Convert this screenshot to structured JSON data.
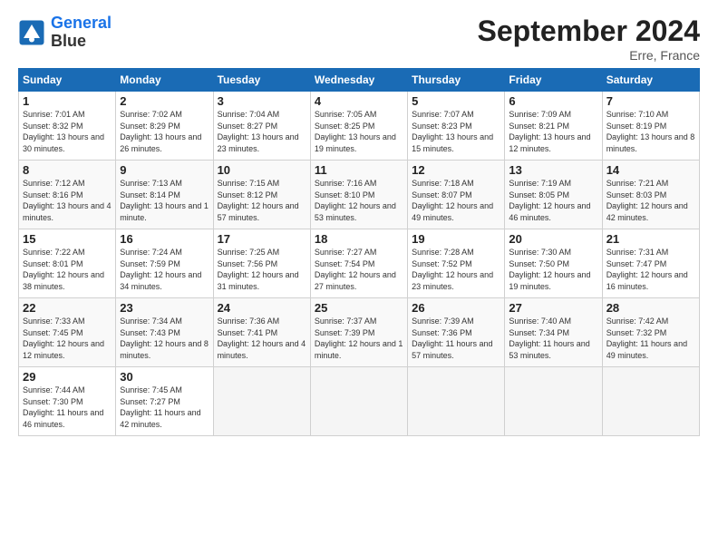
{
  "header": {
    "logo_line1": "General",
    "logo_line2": "Blue",
    "title": "September 2024",
    "location": "Erre, France"
  },
  "days_of_week": [
    "Sunday",
    "Monday",
    "Tuesday",
    "Wednesday",
    "Thursday",
    "Friday",
    "Saturday"
  ],
  "weeks": [
    [
      {
        "num": "1",
        "sunrise": "Sunrise: 7:01 AM",
        "sunset": "Sunset: 8:32 PM",
        "daylight": "Daylight: 13 hours and 30 minutes."
      },
      {
        "num": "2",
        "sunrise": "Sunrise: 7:02 AM",
        "sunset": "Sunset: 8:29 PM",
        "daylight": "Daylight: 13 hours and 26 minutes."
      },
      {
        "num": "3",
        "sunrise": "Sunrise: 7:04 AM",
        "sunset": "Sunset: 8:27 PM",
        "daylight": "Daylight: 13 hours and 23 minutes."
      },
      {
        "num": "4",
        "sunrise": "Sunrise: 7:05 AM",
        "sunset": "Sunset: 8:25 PM",
        "daylight": "Daylight: 13 hours and 19 minutes."
      },
      {
        "num": "5",
        "sunrise": "Sunrise: 7:07 AM",
        "sunset": "Sunset: 8:23 PM",
        "daylight": "Daylight: 13 hours and 15 minutes."
      },
      {
        "num": "6",
        "sunrise": "Sunrise: 7:09 AM",
        "sunset": "Sunset: 8:21 PM",
        "daylight": "Daylight: 13 hours and 12 minutes."
      },
      {
        "num": "7",
        "sunrise": "Sunrise: 7:10 AM",
        "sunset": "Sunset: 8:19 PM",
        "daylight": "Daylight: 13 hours and 8 minutes."
      }
    ],
    [
      {
        "num": "8",
        "sunrise": "Sunrise: 7:12 AM",
        "sunset": "Sunset: 8:16 PM",
        "daylight": "Daylight: 13 hours and 4 minutes."
      },
      {
        "num": "9",
        "sunrise": "Sunrise: 7:13 AM",
        "sunset": "Sunset: 8:14 PM",
        "daylight": "Daylight: 13 hours and 1 minute."
      },
      {
        "num": "10",
        "sunrise": "Sunrise: 7:15 AM",
        "sunset": "Sunset: 8:12 PM",
        "daylight": "Daylight: 12 hours and 57 minutes."
      },
      {
        "num": "11",
        "sunrise": "Sunrise: 7:16 AM",
        "sunset": "Sunset: 8:10 PM",
        "daylight": "Daylight: 12 hours and 53 minutes."
      },
      {
        "num": "12",
        "sunrise": "Sunrise: 7:18 AM",
        "sunset": "Sunset: 8:07 PM",
        "daylight": "Daylight: 12 hours and 49 minutes."
      },
      {
        "num": "13",
        "sunrise": "Sunrise: 7:19 AM",
        "sunset": "Sunset: 8:05 PM",
        "daylight": "Daylight: 12 hours and 46 minutes."
      },
      {
        "num": "14",
        "sunrise": "Sunrise: 7:21 AM",
        "sunset": "Sunset: 8:03 PM",
        "daylight": "Daylight: 12 hours and 42 minutes."
      }
    ],
    [
      {
        "num": "15",
        "sunrise": "Sunrise: 7:22 AM",
        "sunset": "Sunset: 8:01 PM",
        "daylight": "Daylight: 12 hours and 38 minutes."
      },
      {
        "num": "16",
        "sunrise": "Sunrise: 7:24 AM",
        "sunset": "Sunset: 7:59 PM",
        "daylight": "Daylight: 12 hours and 34 minutes."
      },
      {
        "num": "17",
        "sunrise": "Sunrise: 7:25 AM",
        "sunset": "Sunset: 7:56 PM",
        "daylight": "Daylight: 12 hours and 31 minutes."
      },
      {
        "num": "18",
        "sunrise": "Sunrise: 7:27 AM",
        "sunset": "Sunset: 7:54 PM",
        "daylight": "Daylight: 12 hours and 27 minutes."
      },
      {
        "num": "19",
        "sunrise": "Sunrise: 7:28 AM",
        "sunset": "Sunset: 7:52 PM",
        "daylight": "Daylight: 12 hours and 23 minutes."
      },
      {
        "num": "20",
        "sunrise": "Sunrise: 7:30 AM",
        "sunset": "Sunset: 7:50 PM",
        "daylight": "Daylight: 12 hours and 19 minutes."
      },
      {
        "num": "21",
        "sunrise": "Sunrise: 7:31 AM",
        "sunset": "Sunset: 7:47 PM",
        "daylight": "Daylight: 12 hours and 16 minutes."
      }
    ],
    [
      {
        "num": "22",
        "sunrise": "Sunrise: 7:33 AM",
        "sunset": "Sunset: 7:45 PM",
        "daylight": "Daylight: 12 hours and 12 minutes."
      },
      {
        "num": "23",
        "sunrise": "Sunrise: 7:34 AM",
        "sunset": "Sunset: 7:43 PM",
        "daylight": "Daylight: 12 hours and 8 minutes."
      },
      {
        "num": "24",
        "sunrise": "Sunrise: 7:36 AM",
        "sunset": "Sunset: 7:41 PM",
        "daylight": "Daylight: 12 hours and 4 minutes."
      },
      {
        "num": "25",
        "sunrise": "Sunrise: 7:37 AM",
        "sunset": "Sunset: 7:39 PM",
        "daylight": "Daylight: 12 hours and 1 minute."
      },
      {
        "num": "26",
        "sunrise": "Sunrise: 7:39 AM",
        "sunset": "Sunset: 7:36 PM",
        "daylight": "Daylight: 11 hours and 57 minutes."
      },
      {
        "num": "27",
        "sunrise": "Sunrise: 7:40 AM",
        "sunset": "Sunset: 7:34 PM",
        "daylight": "Daylight: 11 hours and 53 minutes."
      },
      {
        "num": "28",
        "sunrise": "Sunrise: 7:42 AM",
        "sunset": "Sunset: 7:32 PM",
        "daylight": "Daylight: 11 hours and 49 minutes."
      }
    ],
    [
      {
        "num": "29",
        "sunrise": "Sunrise: 7:44 AM",
        "sunset": "Sunset: 7:30 PM",
        "daylight": "Daylight: 11 hours and 46 minutes."
      },
      {
        "num": "30",
        "sunrise": "Sunrise: 7:45 AM",
        "sunset": "Sunset: 7:27 PM",
        "daylight": "Daylight: 11 hours and 42 minutes."
      },
      null,
      null,
      null,
      null,
      null
    ]
  ]
}
